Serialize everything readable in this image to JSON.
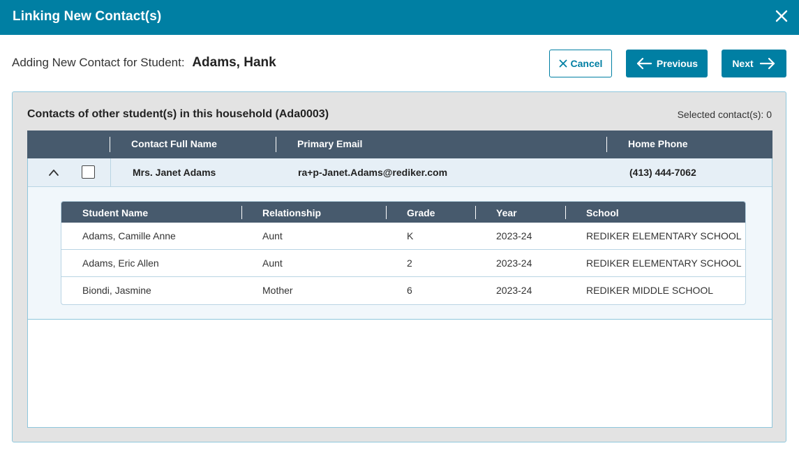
{
  "dialog": {
    "title": "Linking New Contact(s)"
  },
  "header": {
    "prompt": "Adding New Contact for Student:",
    "student_name": "Adams, Hank"
  },
  "buttons": {
    "cancel": "Cancel",
    "previous": "Previous",
    "next": "Next"
  },
  "panel": {
    "title": "Contacts of other student(s) in this household (Ada0003)",
    "selected": "Selected contact(s): 0"
  },
  "contacts_table": {
    "columns": [
      "Contact Full Name",
      "Primary Email",
      "Home Phone"
    ],
    "rows": [
      {
        "name": "Mrs. Janet Adams",
        "email": "ra+p-Janet.Adams@rediker.com",
        "phone": "(413) 444-7062",
        "checked": false,
        "expanded": true
      }
    ]
  },
  "students_table": {
    "columns": [
      "Student Name",
      "Relationship",
      "Grade",
      "Year",
      "School"
    ],
    "rows": [
      [
        "Adams, Camille Anne",
        "Aunt",
        "K",
        "2023-24",
        "REDIKER ELEMENTARY SCHOOL"
      ],
      [
        "Adams, Eric Allen",
        "Aunt",
        "2",
        "2023-24",
        "REDIKER ELEMENTARY SCHOOL"
      ],
      [
        "Biondi, Jasmine",
        "Mother",
        "6",
        "2023-24",
        "REDIKER MIDDLE SCHOOL"
      ]
    ]
  },
  "icons": {
    "close": "close-icon",
    "cancel": "x-icon",
    "previous": "arrow-left-icon",
    "next": "arrow-right-icon",
    "expand": "chevron-up-icon"
  },
  "colors": {
    "brand": "#007fa3",
    "table_header": "#475a6d",
    "panel_bg": "#e3e3e3",
    "row_highlight": "#e6eff6"
  }
}
